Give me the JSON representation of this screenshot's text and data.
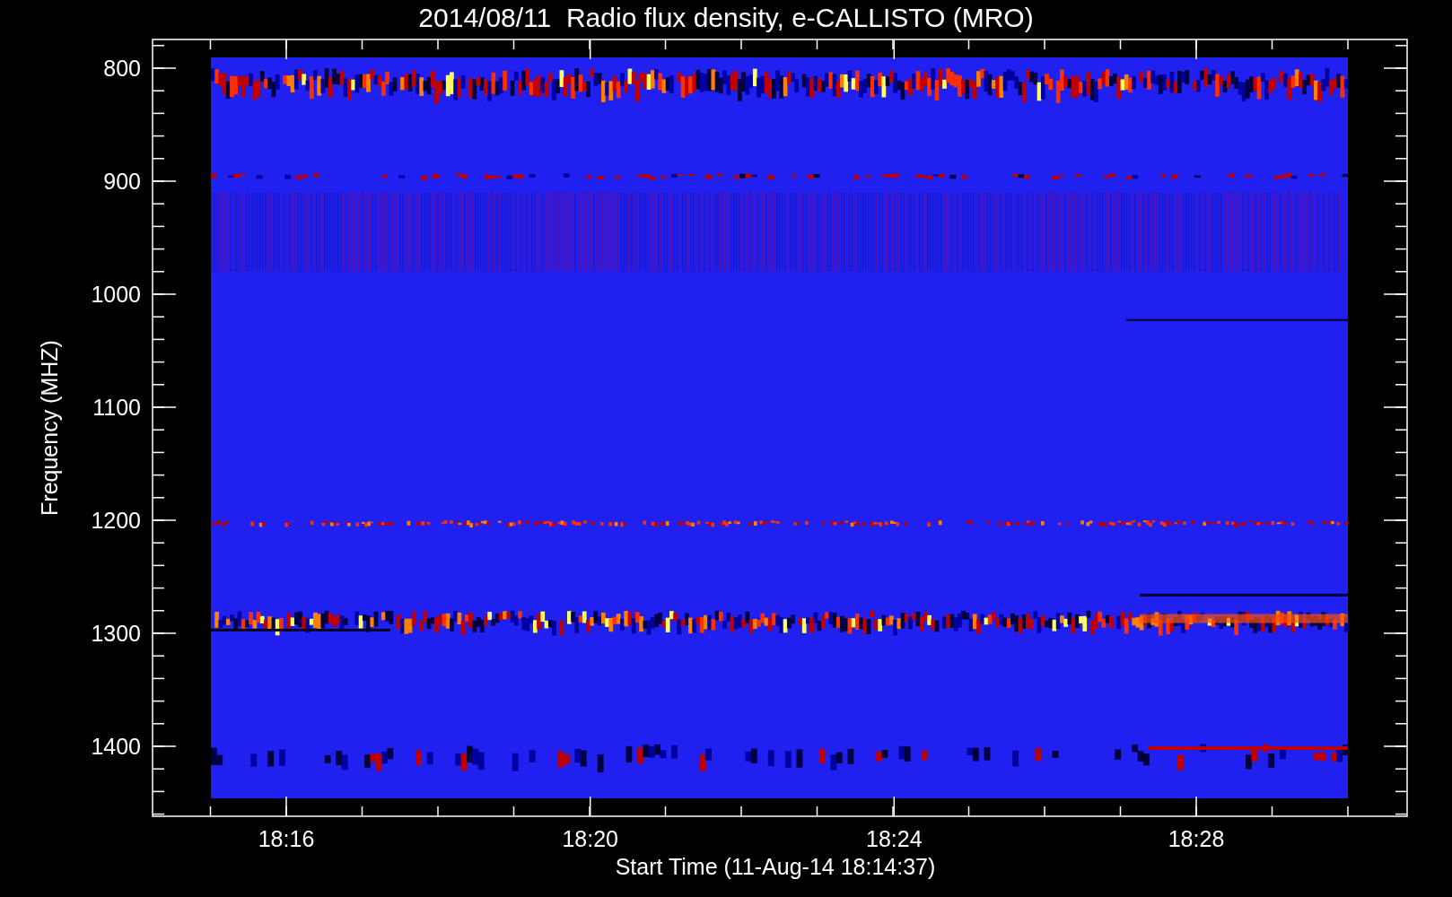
{
  "title": "2014/08/11  Radio flux density, e-CALLISTO (MRO)",
  "y_axis": {
    "label": "Frequency (MHZ)",
    "ticks": [
      "800",
      "900",
      "1000",
      "1100",
      "1200",
      "1300",
      "1400"
    ]
  },
  "x_axis": {
    "label": "Start Time (11-Aug-14 18:14:37)",
    "ticks": [
      "18:16",
      "18:20",
      "18:24",
      "18:28"
    ]
  }
}
